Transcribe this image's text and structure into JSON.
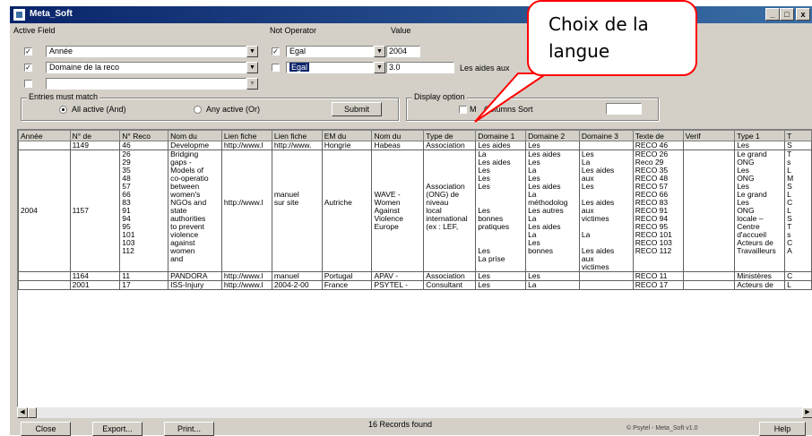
{
  "window": {
    "title": "Meta_Soft",
    "minimize": "_",
    "maximize": "□",
    "close": "x"
  },
  "filters": {
    "col_active_field": "Active  Field",
    "col_not_operator": "Not Operator",
    "col_value": "Value",
    "rows": [
      {
        "checked": "✓",
        "field": "Année",
        "operator": "Egal",
        "value": "2004",
        "selected": false
      },
      {
        "checked": "✓",
        "field": "Domaine de la reco",
        "operator": "Egal",
        "value": "3.0",
        "selected": true
      },
      {
        "checked": "",
        "field": "",
        "operator": "",
        "value": "",
        "selected": false
      }
    ],
    "value_hint": "Les aides aux"
  },
  "entries": {
    "title": "Entries must match",
    "all_active": "All active (And)",
    "any_active": "Any active (Or)",
    "submit": "Submit"
  },
  "display": {
    "title": "Display option",
    "columns_sort": "Columns Sort",
    "partial": "M"
  },
  "callout": {
    "line1": "Choix de la",
    "line2": "langue"
  },
  "table": {
    "headers": [
      "Année",
      "N° de",
      "N° Reco",
      "Nom du",
      "Lien fiche",
      "Lien fiche",
      "EM du",
      "Nom du",
      "Type de",
      "Domaine 1",
      "Domaine 2",
      "Domaine 3",
      "Texte de",
      "Verif",
      "Type 1",
      "T"
    ],
    "rows": [
      {
        "annee": "",
        "nde": "1149",
        "reco": [
          "46"
        ],
        "nom": [
          "Developme"
        ],
        "lien1": [
          "http://www.l"
        ],
        "lien2": [
          "http://www."
        ],
        "em": [
          "Hongrie"
        ],
        "nom2": [
          "Habeas"
        ],
        "type": [
          "Association"
        ],
        "d1": [
          "Les aides"
        ],
        "d2": [
          "Les"
        ],
        "d3": [
          ""
        ],
        "texte": [
          "RECO 46"
        ],
        "verif": "",
        "type1": [
          "Les"
        ],
        "t": [
          "S"
        ]
      },
      {
        "annee": "2004",
        "nde": "1157",
        "reco": [
          "26",
          "29",
          "35",
          "48",
          "57",
          "66",
          "83",
          "91",
          "94",
          "95",
          "101",
          "103",
          "112"
        ],
        "nom": [
          "Bridging",
          "gaps -",
          "Models of",
          "co-operatio",
          "between",
          "women's",
          "NGOs and",
          "state",
          "authorities",
          "to prevent",
          "violence",
          "against",
          "women",
          "and"
        ],
        "lien1": [
          "",
          "",
          "",
          "",
          "",
          "",
          "http://www.l"
        ],
        "lien2": [
          "",
          "",
          "",
          "",
          "",
          "manuel",
          "sur site"
        ],
        "em": [
          "",
          "",
          "",
          "",
          "",
          "",
          "Autriche"
        ],
        "nom2": [
          "",
          "",
          "",
          "",
          "",
          "WAVE -",
          "Women",
          "Against",
          "Violence",
          "Europe"
        ],
        "type": [
          "",
          "",
          "",
          "",
          "Association",
          "(ONG) de",
          "niveau",
          "local",
          "international",
          "(ex : LEF,"
        ],
        "d1": [
          "La",
          "Les aides",
          "Les",
          "Les",
          "Les",
          "",
          "",
          "Les",
          "bonnes",
          "pratiques",
          "",
          "",
          "Les",
          "La prise"
        ],
        "d2": [
          "Les aides",
          "Les",
          "La",
          "Les",
          "Les aides",
          "La",
          "méthodolog",
          "Les autres",
          "La",
          "Les aides",
          "La",
          "Les",
          "bonnes"
        ],
        "d3": [
          "Les",
          "La",
          "Les aides",
          "aux",
          "Les",
          "",
          "Les aides",
          "aux",
          "victimes",
          "",
          "La",
          "",
          "Les aides",
          "aux",
          "victimes"
        ],
        "texte": [
          "RECO 26",
          "Reco 29",
          "RECO 35",
          "RECO 48",
          "RECO 57",
          "RECO 66",
          "RECO 83",
          "RECO 91",
          "RECO 94",
          "RECO 95",
          "RECO 101",
          "RECO 103",
          "RECO 112"
        ],
        "verif": "",
        "type1": [
          "Le grand",
          "ONG",
          "Les",
          "ONG",
          "Les",
          "Le grand",
          "Les",
          "ONG",
          "locale –",
          "Centre",
          "d'accueil",
          "Acteurs de",
          "Travailleurs"
        ],
        "t": [
          "T",
          "s",
          "L",
          "M",
          "S",
          "L",
          "C",
          "L",
          "S",
          "T",
          "s",
          "C",
          "A"
        ]
      },
      {
        "annee": "",
        "nde": "1164",
        "reco": [
          "11"
        ],
        "nom": [
          "PANDORA"
        ],
        "lien1": [
          "http://www.l"
        ],
        "lien2": [
          "manuel"
        ],
        "em": [
          "Portugal"
        ],
        "nom2": [
          "APAV -"
        ],
        "type": [
          "Association"
        ],
        "d1": [
          "Les"
        ],
        "d2": [
          "Les"
        ],
        "d3": [
          ""
        ],
        "texte": [
          "RECO 11"
        ],
        "verif": "",
        "type1": [
          "Ministères"
        ],
        "t": [
          "C"
        ]
      },
      {
        "annee": "",
        "nde": "2001",
        "reco": [
          "17"
        ],
        "nom": [
          "ISS-Injury"
        ],
        "lien1": [
          "http://www.l"
        ],
        "lien2": [
          "2004-2-00"
        ],
        "em": [
          "France"
        ],
        "nom2": [
          "PSYTEL -"
        ],
        "type": [
          "Consultant"
        ],
        "d1": [
          "Les"
        ],
        "d2": [
          "La"
        ],
        "d3": [
          ""
        ],
        "texte": [
          "RECO 17"
        ],
        "verif": "",
        "type1": [
          "Acteurs de"
        ],
        "t": [
          "L"
        ]
      }
    ]
  },
  "footer": {
    "close": "Close",
    "export": "Export...",
    "print": "Print...",
    "status": "16 Records found",
    "help": "Help",
    "corner": "© Psytel - Meta_Soft v1.0"
  }
}
